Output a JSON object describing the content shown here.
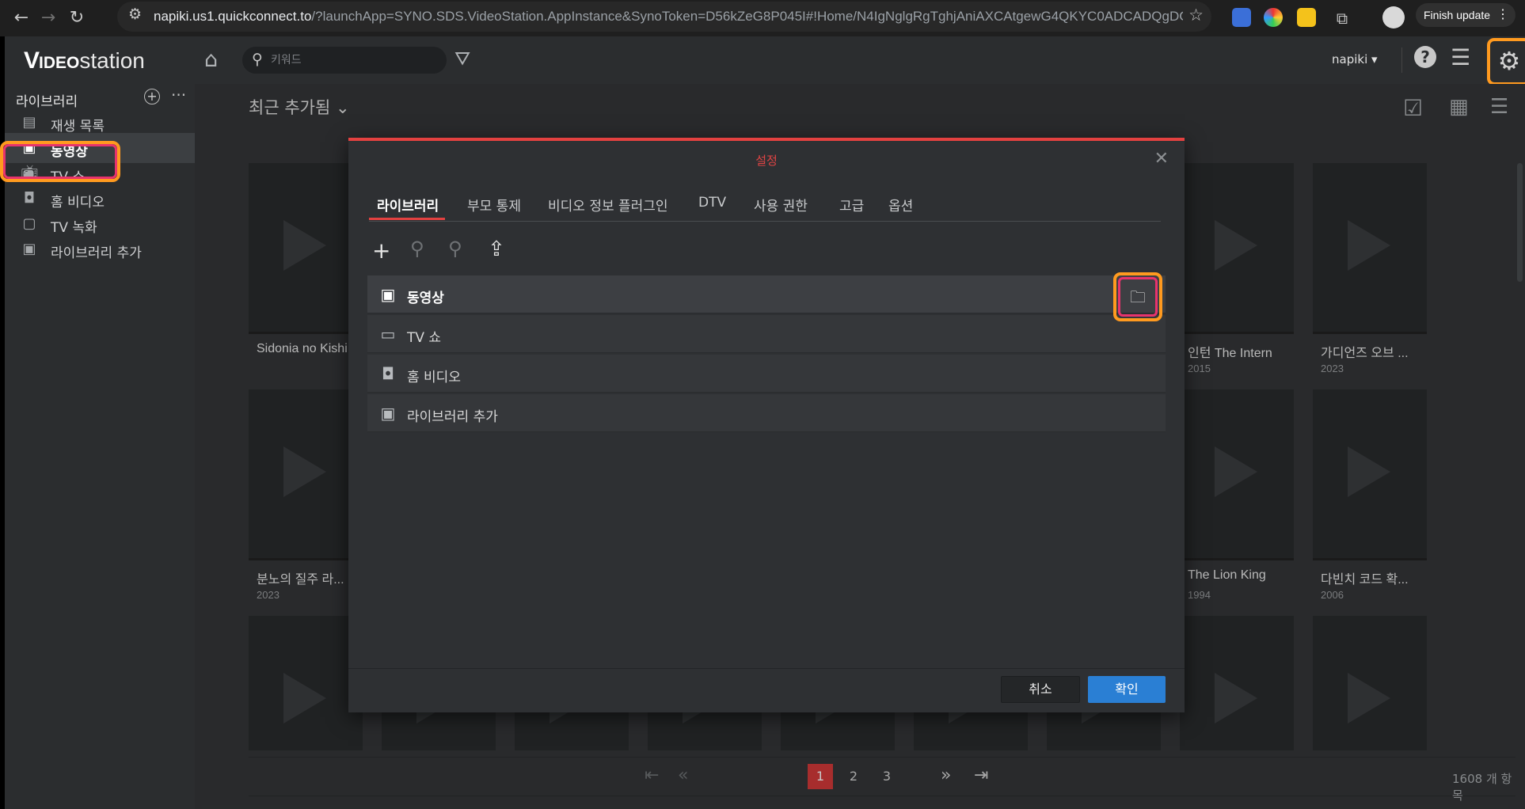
{
  "browser": {
    "url_host": "napiki.us1.quickconnect.to",
    "url_path": "/?launchApp=SYNO.SDS.VideoStation.AppInstance&SynoToken=D56kZeG8P045I#!Home/N4IgNglgRgTghjAniAXCAtgewG4QKYC0ADCADQgDGcA...",
    "finish_update": "Finish update"
  },
  "app": {
    "logo_v": "V",
    "logo_ideo": "IDEO",
    "logo_station": "station",
    "search_placeholder": "키워드",
    "user": "napiki ▾"
  },
  "sidebar": {
    "header": "라이브러리",
    "items": [
      {
        "label": "재생 목록",
        "icon": "playlist-icon"
      },
      {
        "label": "동영상",
        "icon": "film-icon"
      },
      {
        "label": "TV 쇼",
        "icon": "tv-icon"
      },
      {
        "label": "홈 비디오",
        "icon": "camcorder-icon"
      },
      {
        "label": "TV 녹화",
        "icon": "tv-record-icon"
      },
      {
        "label": "라이브러리 추가",
        "icon": "film-icon"
      }
    ]
  },
  "main": {
    "section_title": "최근 추가됨 ⌄",
    "cards": [
      {
        "title": "Sidonia no Kishi",
        "year": ""
      },
      {
        "title": "인턴 The Intern",
        "year": "2015"
      },
      {
        "title": "가디언즈 오브 ...",
        "year": "2023"
      },
      {
        "title": "분노의 질주 라...",
        "year": "2023"
      },
      {
        "title": "The Lion King",
        "year": "1994"
      },
      {
        "title": "다빈치 코드 확...",
        "year": "2006"
      }
    ],
    "pagination": {
      "pages": [
        "1",
        "2",
        "3"
      ],
      "current": "1"
    },
    "item_count": "1608 개 항목"
  },
  "dialog": {
    "title": "설정",
    "tabs": [
      "라이브러리",
      "부모 통제",
      "비디오 정보 플러그인",
      "DTV",
      "사용 권한",
      "고급",
      "옵션"
    ],
    "active_tab": "라이브러리",
    "libraries": [
      {
        "label": "동영상",
        "icon": "film-icon"
      },
      {
        "label": "TV 쇼",
        "icon": "tv-icon"
      },
      {
        "label": "홈 비디오",
        "icon": "camcorder-icon"
      },
      {
        "label": "라이브러리 추가",
        "icon": "film-icon"
      }
    ],
    "cancel": "취소",
    "confirm": "확인"
  },
  "colors": {
    "accent_red": "#e34140",
    "highlight_orange": "#ff9a1f",
    "highlight_pink": "#e8336d",
    "confirm_blue": "#2a7fd4"
  }
}
